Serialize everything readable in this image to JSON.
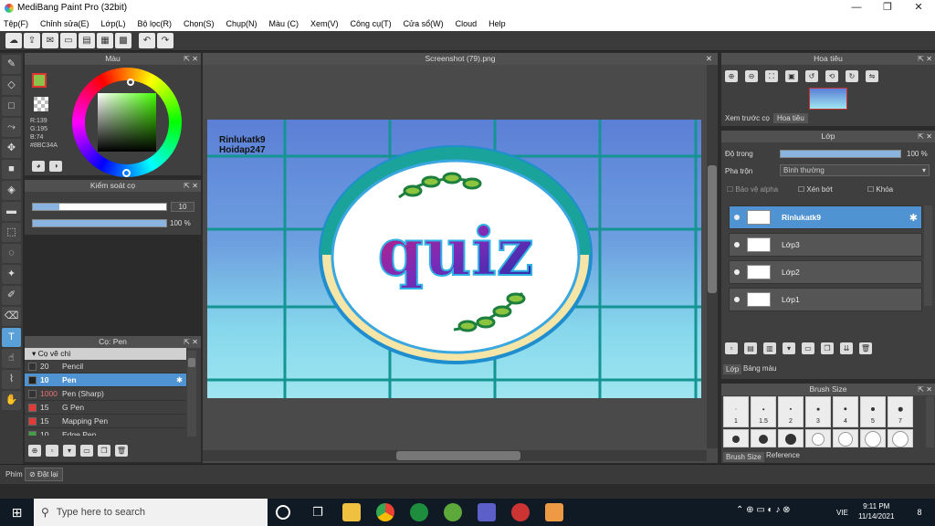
{
  "window": {
    "title": "MediBang Paint Pro (32bit)",
    "minimize": "—",
    "restore": "❐",
    "close": "✕"
  },
  "menu": [
    "Tệp(F)",
    "Chỉnh sửa(E)",
    "Lớp(L)",
    "Bộ lọc(R)",
    "Chọn(S)",
    "Chụp(N)",
    "Màu (C)",
    "Xem(V)",
    "Công cụ(T)",
    "Cửa sổ(W)",
    "Cloud",
    "Help"
  ],
  "toolbar": {
    "icons": [
      "cloud-icon",
      "share-icon",
      "comment-icon",
      "page-icon",
      "save-icon",
      "material-icon",
      "grid-icon",
      "undo-icon",
      "redo-icon"
    ]
  },
  "color_panel": {
    "title": "Màu",
    "r": "R:139",
    "g": "G:195",
    "b": "B:74",
    "hex": "#8BC34A",
    "current_color": "#8bc34a"
  },
  "brush_control": {
    "title": "Kiểm soát cọ",
    "size": "10",
    "opacity": "100 %",
    "size_fraction": 0.2,
    "opacity_fraction": 1.0
  },
  "brush_panel": {
    "title": "Cọ: Pen",
    "group": "Cọ vẽ chì",
    "items": [
      {
        "size": "20",
        "name": "Pencil",
        "color": "#333333",
        "selected": false
      },
      {
        "size": "10",
        "name": "Pen",
        "color": "#222222",
        "selected": true
      },
      {
        "size": "1000",
        "name": "Pen (Sharp)",
        "color": "#333333",
        "selected": false
      },
      {
        "size": "15",
        "name": "G Pen",
        "color": "#e53935",
        "selected": false
      },
      {
        "size": "15",
        "name": "Mapping Pen",
        "color": "#e53935",
        "selected": false
      },
      {
        "size": "10",
        "name": "Edge Pen",
        "color": "#43a047",
        "selected": false
      }
    ]
  },
  "canvas": {
    "tab_title": "Screenshot (79).png",
    "watermark_line1": "Rinlukatk9",
    "watermark_line2": "Hoidap247",
    "art_text": "quiz"
  },
  "navigator": {
    "title": "Hoa tiêu",
    "tab_preview": "Xem trước cọ",
    "tab_navigator": "Hoa tiêu"
  },
  "layers": {
    "title": "Lớp",
    "opacity_label": "Độ trong",
    "opacity_value": "100 %",
    "opacity_fraction": 1.0,
    "blend_label": "Pha trộn",
    "blend_value": "Bình thường",
    "protect_alpha": "Bảo vệ alpha",
    "clipping": "Xén bớt",
    "lock": "Khóa",
    "rows": [
      {
        "name": "Rinlukatk9",
        "selected": true
      },
      {
        "name": "Lớp3",
        "selected": false
      },
      {
        "name": "Lớp2",
        "selected": false
      },
      {
        "name": "Lớp1",
        "selected": false
      }
    ],
    "tab_layer": "Lớp",
    "tab_material": "Bảng màu"
  },
  "brush_size": {
    "title": "Brush Size",
    "sizes": [
      "1",
      "1.5",
      "2",
      "3",
      "4",
      "5",
      "7"
    ],
    "tab_size": "Brush Size",
    "tab_reference": "Reference"
  },
  "statusbar": {
    "shortcut_label": "Phím",
    "settings_label": "Đặt lại"
  },
  "taskbar": {
    "search_placeholder": "Type here to search",
    "time": "9:11 PM",
    "date": "11/14/2021",
    "lang": "VIE",
    "notifications": "8"
  }
}
